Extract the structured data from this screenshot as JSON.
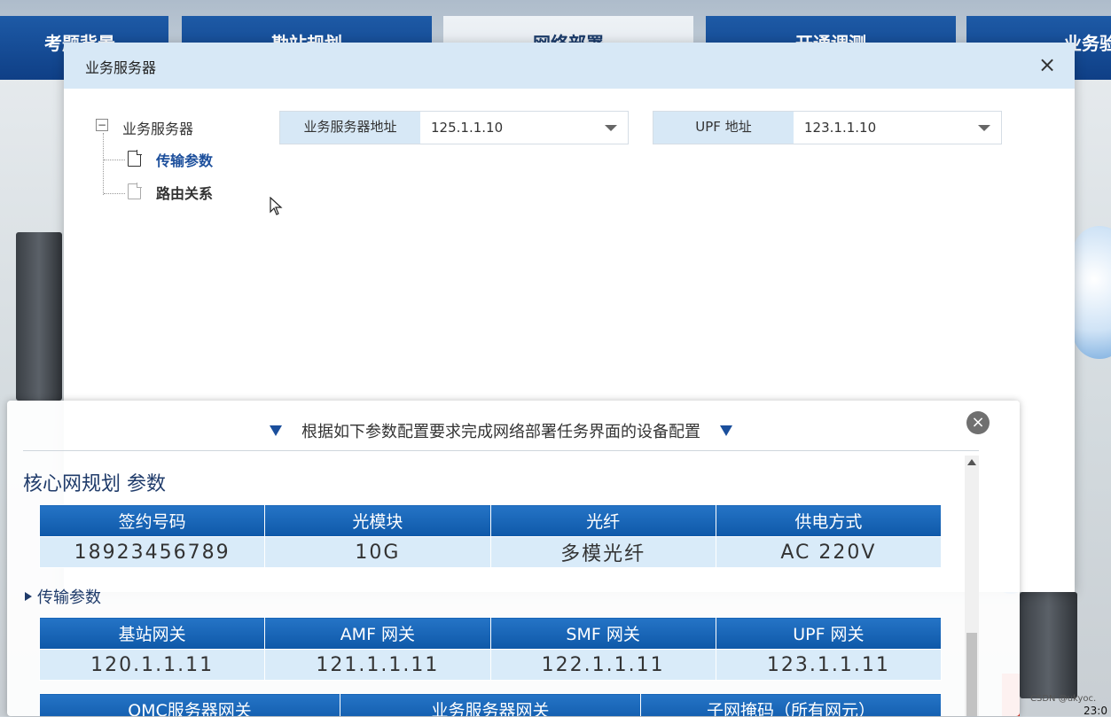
{
  "nav": {
    "tabs": [
      {
        "label": "考题背景"
      },
      {
        "label": "勘站规划"
      },
      {
        "label": "网络部署"
      },
      {
        "label": "开通调测"
      },
      {
        "label": "业务验"
      }
    ]
  },
  "dialog": {
    "title": "业务服务器",
    "close_icon": "×",
    "tree": {
      "root_label": "业务服务器",
      "collapse_glyph": "−",
      "children": [
        {
          "label": "传输参数",
          "selected": true
        },
        {
          "label": "路由关系",
          "selected": false
        }
      ]
    },
    "fields": [
      {
        "label": "业务服务器地址",
        "value": "125.1.1.10"
      },
      {
        "label": "UPF 地址",
        "value": "123.1.1.10"
      }
    ]
  },
  "panel": {
    "title": "根据如下参数配置要求完成网络部署任务界面的设备配置",
    "close_icon": "×",
    "section_title": "核心网规划 参数",
    "table1": {
      "headers": [
        "签约号码",
        "光模块",
        "光纤",
        "供电方式"
      ],
      "row": [
        "18923456789",
        "10G",
        "多模光纤",
        "AC 220V"
      ]
    },
    "subsection_title": "传输参数",
    "table2": {
      "headers": [
        "基站网关",
        "AMF 网关",
        "SMF 网关",
        "UPF 网关"
      ],
      "row": [
        "120.1.1.11",
        "121.1.1.11",
        "122.1.1.11",
        "123.1.1.11"
      ]
    },
    "table3": {
      "headers": [
        "OMC服务器网关",
        "业务服务器网关",
        "子网掩码（所有网元）"
      ]
    }
  },
  "watermark": "CSDN @ukyoc.",
  "clock": "23:0"
}
